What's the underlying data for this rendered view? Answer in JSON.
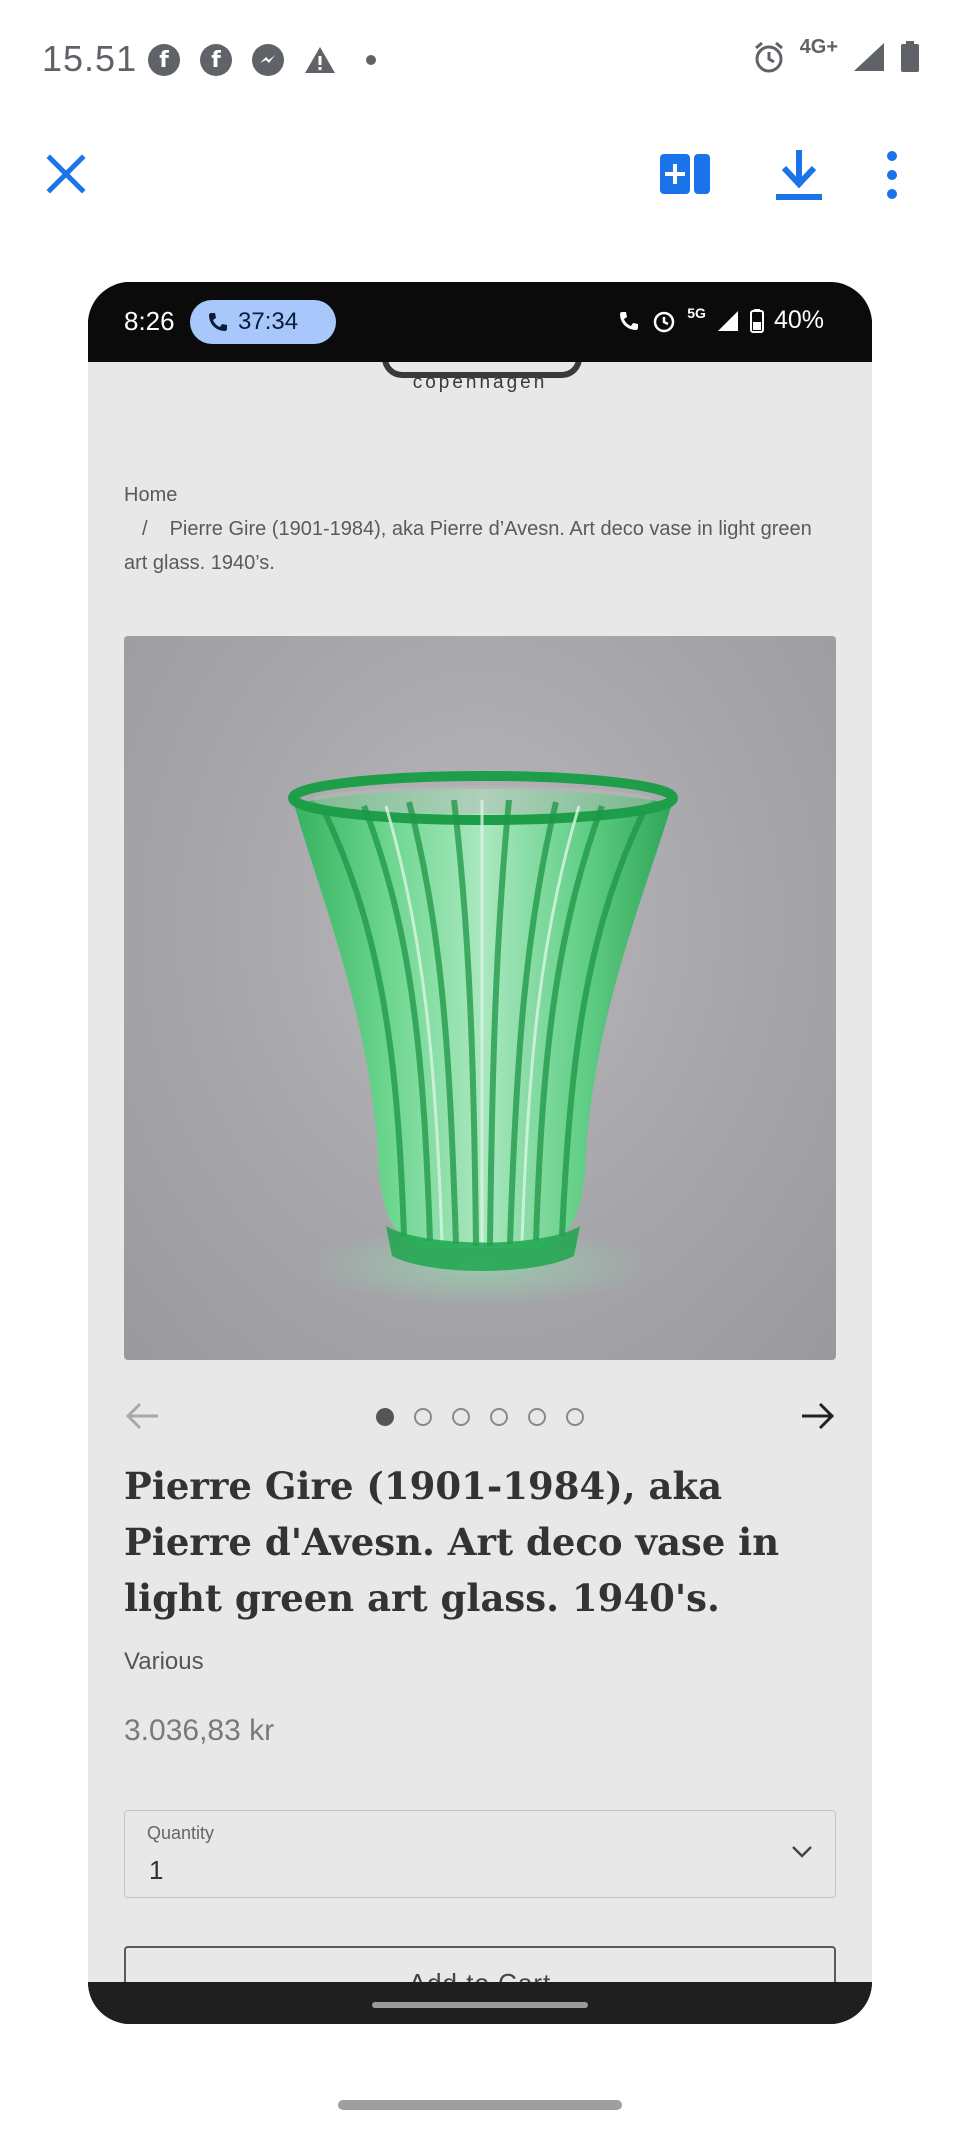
{
  "outer_status": {
    "time": "15.51",
    "network": "4G+"
  },
  "viewer_toolbar": {
    "icons": [
      "close-icon",
      "add-to-icon",
      "download-icon",
      "more-vert-icon"
    ],
    "accent_color": "#1a73e8"
  },
  "inner_status": {
    "time": "8:26",
    "call_timer": "37:34",
    "network": "5G",
    "battery": "40%"
  },
  "site": {
    "logo_sub": "copenhagen"
  },
  "breadcrumb": {
    "home": "Home",
    "separator": "/",
    "current": "Pierre Gire (1901-1984), aka Pierre d’Avesn. Art deco vase in light green art glass. 1940’s."
  },
  "gallery": {
    "image_count": 6,
    "active_index": 0
  },
  "product": {
    "title": "Pierre Gire (1901-1984), aka Pierre d'Avesn. Art deco vase in light green art glass. 1940's.",
    "vendor": "Various",
    "price": "3.036,83 kr"
  },
  "quantity": {
    "label": "Quantity",
    "value": "1"
  },
  "add_to_cart": {
    "label": "Add to Cart"
  }
}
